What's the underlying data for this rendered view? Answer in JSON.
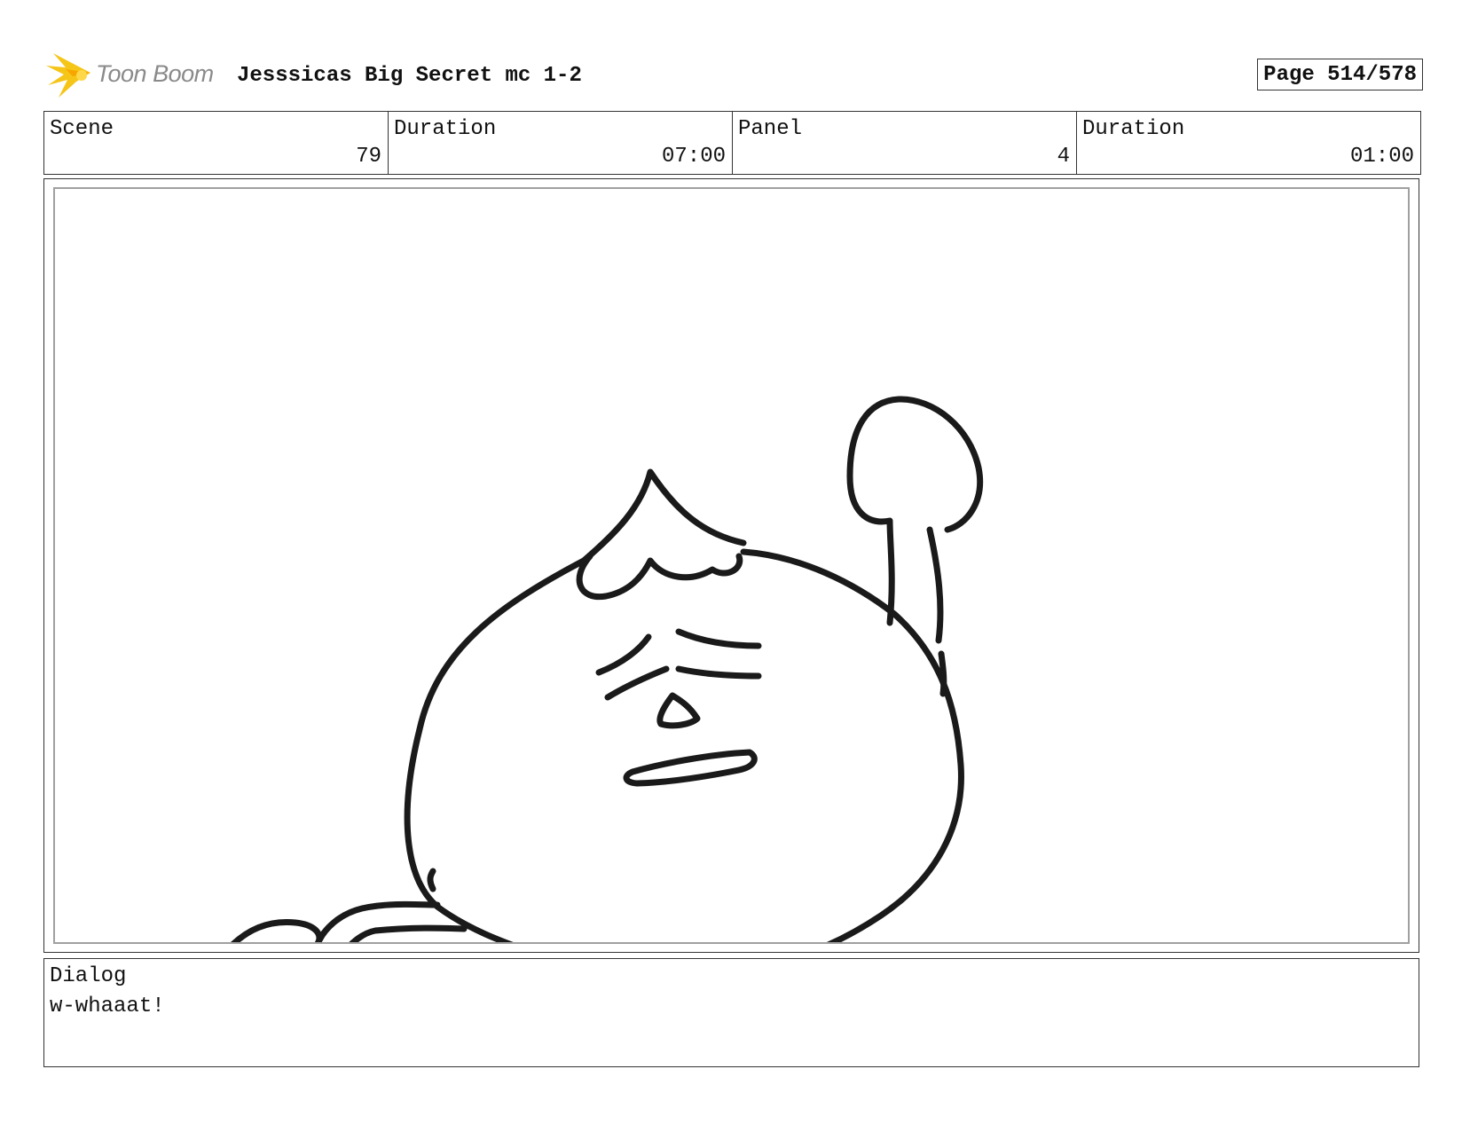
{
  "header": {
    "logo_text": "Toon Boom",
    "project_title": "Jesssicas Big Secret mc 1-2",
    "page_label": "Page 514/578"
  },
  "info": {
    "scene_label": "Scene",
    "scene_value": "79",
    "scene_duration_label": "Duration",
    "scene_duration_value": "07:00",
    "panel_label": "Panel",
    "panel_value": "4",
    "panel_duration_label": "Duration",
    "panel_duration_value": "01:00"
  },
  "dialog": {
    "label": "Dialog",
    "text": "w-whaaat!"
  },
  "colors": {
    "logo_star": "#f5c518",
    "logo_text": "#8a8a8a",
    "ink": "#1a1a1a",
    "panel_border": "#a0a0a0"
  }
}
